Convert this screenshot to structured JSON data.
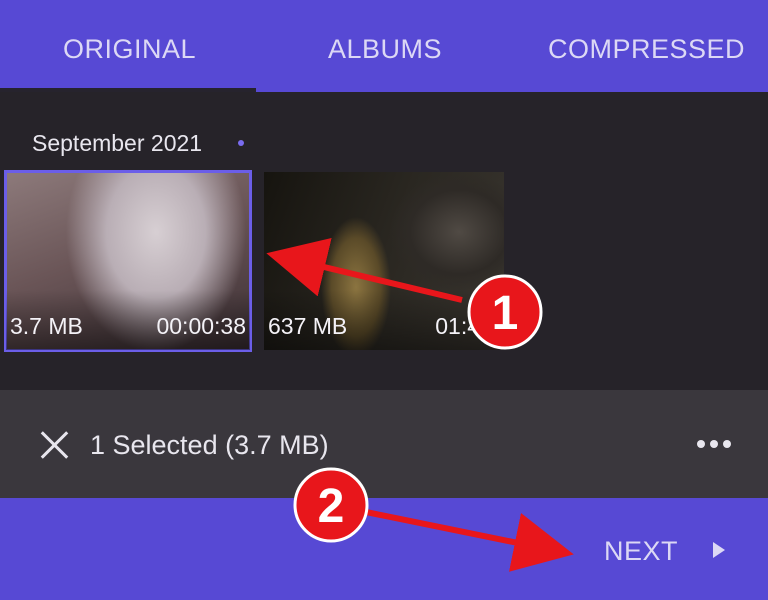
{
  "tabs": [
    {
      "label": "ORIGINAL",
      "active": true
    },
    {
      "label": "ALBUMS",
      "active": false
    },
    {
      "label": "COMPRESSED",
      "active": false
    }
  ],
  "section": {
    "title": "September 2021"
  },
  "videos": [
    {
      "size": "3.7 MB",
      "duration": "00:00:38",
      "selected": true
    },
    {
      "size": "637 MB",
      "duration": "01:45:2",
      "selected": false
    }
  ],
  "selection": {
    "text": "1 Selected (3.7 MB)"
  },
  "footer": {
    "next_label": "NEXT"
  },
  "annotations": [
    {
      "number": "1"
    },
    {
      "number": "2"
    }
  ],
  "colors": {
    "accent": "#5749d4",
    "content_bg": "#262329",
    "selection_bar": "#3a373d",
    "annotation_red": "#e8161b"
  },
  "icons": [
    "close-icon",
    "more-icon",
    "play-arrow-icon"
  ]
}
